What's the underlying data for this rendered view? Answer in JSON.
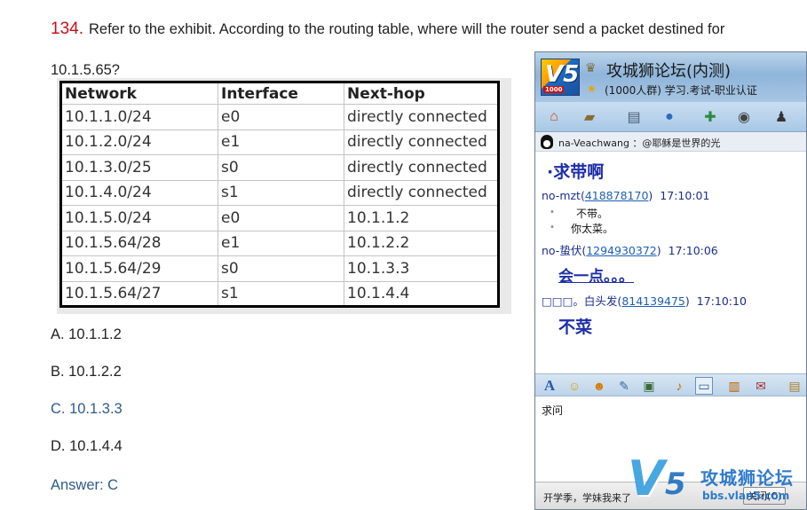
{
  "question": {
    "number": "134.",
    "text_line1": "Refer to the exhibit. According to the routing table, where will the router send a packet destined for",
    "text_line2": "10.1.5.65?"
  },
  "routing_table": {
    "headers": [
      "Network",
      "Interface",
      "Next-hop"
    ],
    "rows": [
      [
        "10.1.1.0/24",
        "e0",
        "directly connected"
      ],
      [
        "10.1.2.0/24",
        "e1",
        "directly connected"
      ],
      [
        "10.1.3.0/25",
        "s0",
        "directly connected"
      ],
      [
        "10.1.4.0/24",
        "s1",
        "directly connected"
      ],
      [
        "10.1.5.0/24",
        "e0",
        "10.1.1.2"
      ],
      [
        "10.1.5.64/28",
        "e1",
        "10.1.2.2"
      ],
      [
        "10.1.5.64/29",
        "s0",
        "10.1.3.3"
      ],
      [
        "10.1.5.64/27",
        "s1",
        "10.1.4.4"
      ]
    ]
  },
  "options": [
    {
      "text": "A. 10.1.1.2"
    },
    {
      "text": "B. 10.1.2.2"
    },
    {
      "text": "C. 10.1.3.3"
    },
    {
      "text": "D. 10.1.4.4"
    }
  ],
  "answer": "Answer: C",
  "chat": {
    "logo_text": "V5",
    "logo_badge": "1000",
    "title": "攻城狮论坛(内测)",
    "subtitle": "(1000人群) 学习.考试-职业认证",
    "notice": "na-Veachwang ：@耶稣是世界的光",
    "messages": [
      {
        "kind": "big",
        "text": "·求带啊"
      },
      {
        "kind": "sender",
        "name": "no-mzt(",
        "qq": "418878170",
        "close": ")",
        "time": "17:10:01"
      },
      {
        "kind": "small",
        "text": "不带。"
      },
      {
        "kind": "small",
        "text": "你太菜。"
      },
      {
        "kind": "sender",
        "name": "no-蛰伏(",
        "qq": "1294930372",
        "close": ")",
        "time": "17:10:06"
      },
      {
        "kind": "big",
        "text": "会一点。。。"
      },
      {
        "kind": "sender",
        "name": "□□□。白头发(",
        "qq": "814139475",
        "close": ")",
        "time": "17:10:10"
      },
      {
        "kind": "big",
        "text": "不菜"
      }
    ],
    "input_text": "求问",
    "bottom_text": "开学季，学妹我来了",
    "close_button": "关闭(C)"
  },
  "watermark": {
    "letter": "V",
    "digit": "5",
    "title": "攻城狮论坛",
    "url": "bbs.vlan5.com"
  }
}
